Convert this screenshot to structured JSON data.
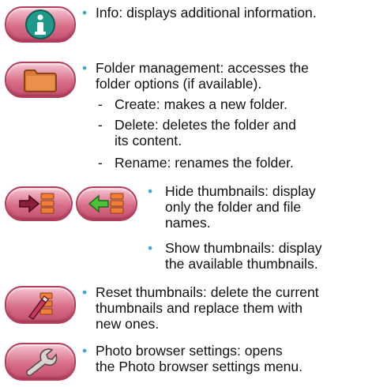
{
  "items": [
    {
      "icon": "info-icon",
      "text": "Info: displays additional information."
    },
    {
      "icon": "folder-icon",
      "lines": [
        "Folder management: accesses the",
        "folder options (if available)."
      ]
    },
    {
      "sub": [
        {
          "lines": [
            "Create: makes a new folder."
          ]
        },
        {
          "lines": [
            "Delete: deletes the folder and",
            "its content."
          ]
        },
        {
          "lines": [
            "Rename: renames the folder."
          ]
        }
      ]
    },
    {
      "icons": [
        "hide-thumbnails-icon",
        "show-thumbnails-icon"
      ],
      "bullets": [
        {
          "lines": [
            "Hide thumbnails: display",
            "only the folder and file",
            "names."
          ]
        },
        {
          "lines": [
            "Show thumbnails: display",
            "the available thumbnails."
          ]
        }
      ]
    },
    {
      "icon": "reset-thumbnails-icon",
      "lines": [
        "Reset thumbnails: delete the current",
        "thumbnails and replace them with",
        "new ones."
      ]
    },
    {
      "icon": "wrench-icon",
      "lines": [
        "Photo browser settings: opens",
        "the Photo browser settings menu."
      ]
    }
  ],
  "bullet_char": "•",
  "dash_char": "-",
  "colors": {
    "bullet": "#3fa9d6",
    "icon_bg": "#d86e8a",
    "icon_border": "#b23e5c"
  }
}
